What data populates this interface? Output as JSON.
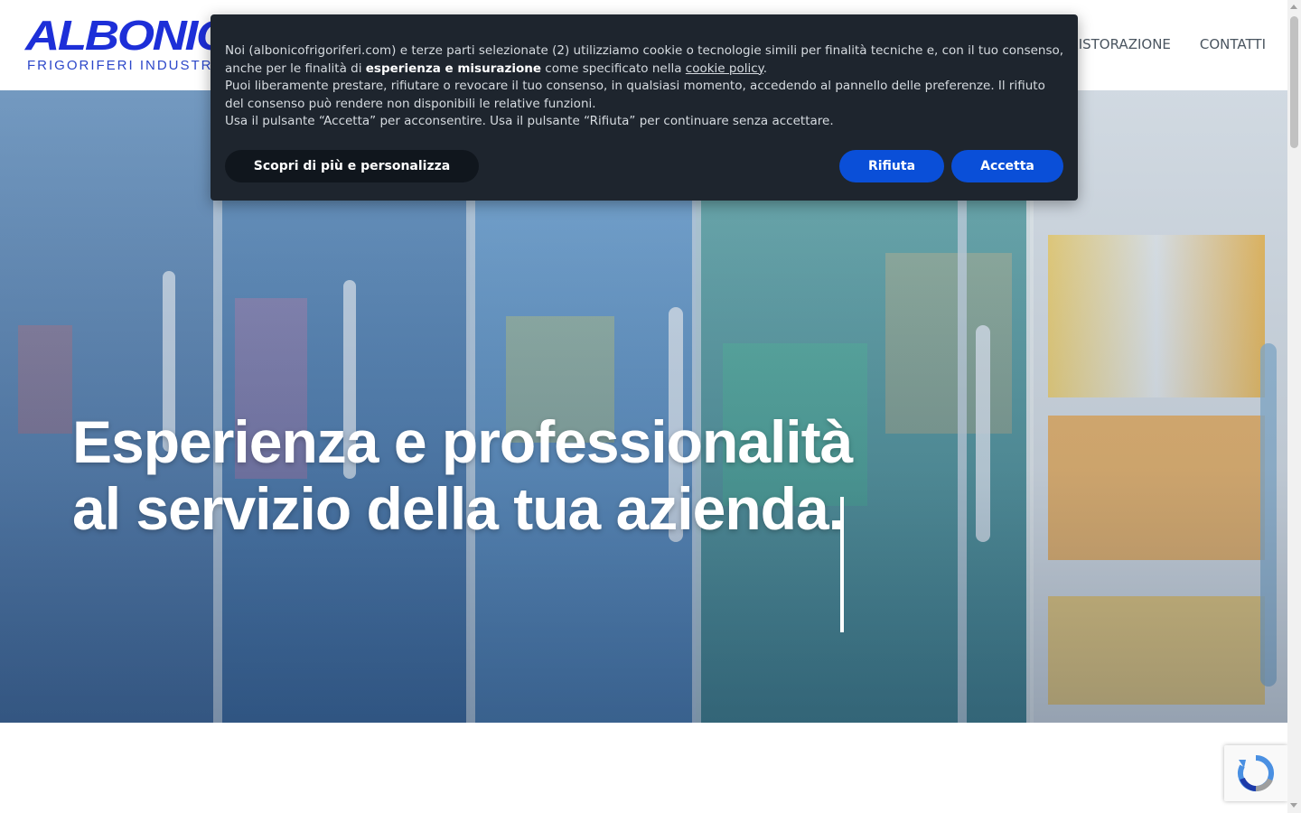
{
  "header": {
    "logo": {
      "word": "ALBONICO",
      "subtitle": "FRIGORIFERI INDUSTRIALI"
    },
    "nav": [
      {
        "label": "RISTORAZIONE"
      },
      {
        "label": "CONTATTI"
      }
    ]
  },
  "hero": {
    "headline_line1": "Esperienza e professionalità",
    "headline_line2": "al servizio della tua azienda."
  },
  "cookie_banner": {
    "p1_pre": "Noi (albonicofrigoriferi.com) e terze parti selezionate (2) utilizziamo cookie o tecnologie simili per finalità tecniche e, con il tuo consenso, anche per le finalità di ",
    "p1_bold": "esperienza e misurazione",
    "p1_mid": " come specificato nella ",
    "p1_link": "cookie policy",
    "p1_end": ".",
    "p2": "Puoi liberamente prestare, rifiutare o revocare il tuo consenso, in qualsiasi momento, accedendo al pannello delle preferenze. Il rifiuto del consenso può rendere non disponibili le relative funzioni.",
    "p3": "Usa il pulsante “Accetta” per acconsentire. Usa il pulsante “Rifiuta” per continuare senza accettare.",
    "btn_more": "Scopri di più e personalizza",
    "btn_reject": "Rifiuta",
    "btn_accept": "Accetta"
  },
  "colors": {
    "brand_blue": "#1d2fd8",
    "banner_bg": "#1e252e",
    "button_blue": "#0a4fd8"
  }
}
